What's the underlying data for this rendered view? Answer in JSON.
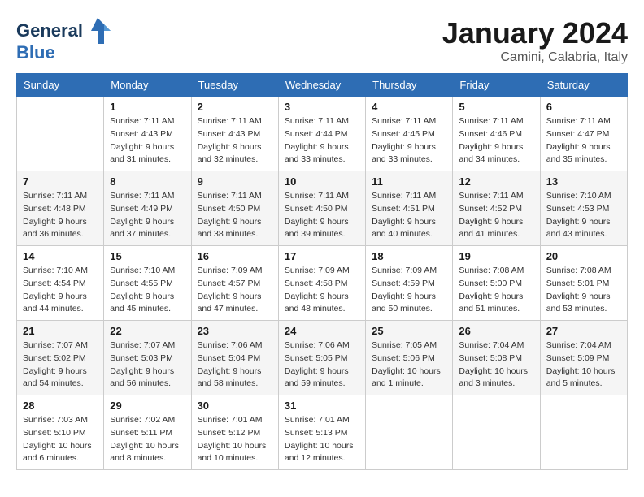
{
  "header": {
    "logo_line1": "General",
    "logo_line2": "Blue",
    "month": "January 2024",
    "location": "Camini, Calabria, Italy"
  },
  "weekdays": [
    "Sunday",
    "Monday",
    "Tuesday",
    "Wednesday",
    "Thursday",
    "Friday",
    "Saturday"
  ],
  "weeks": [
    [
      {
        "day": "",
        "sunrise": "",
        "sunset": "",
        "daylight": ""
      },
      {
        "day": "1",
        "sunrise": "Sunrise: 7:11 AM",
        "sunset": "Sunset: 4:43 PM",
        "daylight": "Daylight: 9 hours and 31 minutes."
      },
      {
        "day": "2",
        "sunrise": "Sunrise: 7:11 AM",
        "sunset": "Sunset: 4:43 PM",
        "daylight": "Daylight: 9 hours and 32 minutes."
      },
      {
        "day": "3",
        "sunrise": "Sunrise: 7:11 AM",
        "sunset": "Sunset: 4:44 PM",
        "daylight": "Daylight: 9 hours and 33 minutes."
      },
      {
        "day": "4",
        "sunrise": "Sunrise: 7:11 AM",
        "sunset": "Sunset: 4:45 PM",
        "daylight": "Daylight: 9 hours and 33 minutes."
      },
      {
        "day": "5",
        "sunrise": "Sunrise: 7:11 AM",
        "sunset": "Sunset: 4:46 PM",
        "daylight": "Daylight: 9 hours and 34 minutes."
      },
      {
        "day": "6",
        "sunrise": "Sunrise: 7:11 AM",
        "sunset": "Sunset: 4:47 PM",
        "daylight": "Daylight: 9 hours and 35 minutes."
      }
    ],
    [
      {
        "day": "7",
        "sunrise": "Sunrise: 7:11 AM",
        "sunset": "Sunset: 4:48 PM",
        "daylight": "Daylight: 9 hours and 36 minutes."
      },
      {
        "day": "8",
        "sunrise": "Sunrise: 7:11 AM",
        "sunset": "Sunset: 4:49 PM",
        "daylight": "Daylight: 9 hours and 37 minutes."
      },
      {
        "day": "9",
        "sunrise": "Sunrise: 7:11 AM",
        "sunset": "Sunset: 4:50 PM",
        "daylight": "Daylight: 9 hours and 38 minutes."
      },
      {
        "day": "10",
        "sunrise": "Sunrise: 7:11 AM",
        "sunset": "Sunset: 4:50 PM",
        "daylight": "Daylight: 9 hours and 39 minutes."
      },
      {
        "day": "11",
        "sunrise": "Sunrise: 7:11 AM",
        "sunset": "Sunset: 4:51 PM",
        "daylight": "Daylight: 9 hours and 40 minutes."
      },
      {
        "day": "12",
        "sunrise": "Sunrise: 7:11 AM",
        "sunset": "Sunset: 4:52 PM",
        "daylight": "Daylight: 9 hours and 41 minutes."
      },
      {
        "day": "13",
        "sunrise": "Sunrise: 7:10 AM",
        "sunset": "Sunset: 4:53 PM",
        "daylight": "Daylight: 9 hours and 43 minutes."
      }
    ],
    [
      {
        "day": "14",
        "sunrise": "Sunrise: 7:10 AM",
        "sunset": "Sunset: 4:54 PM",
        "daylight": "Daylight: 9 hours and 44 minutes."
      },
      {
        "day": "15",
        "sunrise": "Sunrise: 7:10 AM",
        "sunset": "Sunset: 4:55 PM",
        "daylight": "Daylight: 9 hours and 45 minutes."
      },
      {
        "day": "16",
        "sunrise": "Sunrise: 7:09 AM",
        "sunset": "Sunset: 4:57 PM",
        "daylight": "Daylight: 9 hours and 47 minutes."
      },
      {
        "day": "17",
        "sunrise": "Sunrise: 7:09 AM",
        "sunset": "Sunset: 4:58 PM",
        "daylight": "Daylight: 9 hours and 48 minutes."
      },
      {
        "day": "18",
        "sunrise": "Sunrise: 7:09 AM",
        "sunset": "Sunset: 4:59 PM",
        "daylight": "Daylight: 9 hours and 50 minutes."
      },
      {
        "day": "19",
        "sunrise": "Sunrise: 7:08 AM",
        "sunset": "Sunset: 5:00 PM",
        "daylight": "Daylight: 9 hours and 51 minutes."
      },
      {
        "day": "20",
        "sunrise": "Sunrise: 7:08 AM",
        "sunset": "Sunset: 5:01 PM",
        "daylight": "Daylight: 9 hours and 53 minutes."
      }
    ],
    [
      {
        "day": "21",
        "sunrise": "Sunrise: 7:07 AM",
        "sunset": "Sunset: 5:02 PM",
        "daylight": "Daylight: 9 hours and 54 minutes."
      },
      {
        "day": "22",
        "sunrise": "Sunrise: 7:07 AM",
        "sunset": "Sunset: 5:03 PM",
        "daylight": "Daylight: 9 hours and 56 minutes."
      },
      {
        "day": "23",
        "sunrise": "Sunrise: 7:06 AM",
        "sunset": "Sunset: 5:04 PM",
        "daylight": "Daylight: 9 hours and 58 minutes."
      },
      {
        "day": "24",
        "sunrise": "Sunrise: 7:06 AM",
        "sunset": "Sunset: 5:05 PM",
        "daylight": "Daylight: 9 hours and 59 minutes."
      },
      {
        "day": "25",
        "sunrise": "Sunrise: 7:05 AM",
        "sunset": "Sunset: 5:06 PM",
        "daylight": "Daylight: 10 hours and 1 minute."
      },
      {
        "day": "26",
        "sunrise": "Sunrise: 7:04 AM",
        "sunset": "Sunset: 5:08 PM",
        "daylight": "Daylight: 10 hours and 3 minutes."
      },
      {
        "day": "27",
        "sunrise": "Sunrise: 7:04 AM",
        "sunset": "Sunset: 5:09 PM",
        "daylight": "Daylight: 10 hours and 5 minutes."
      }
    ],
    [
      {
        "day": "28",
        "sunrise": "Sunrise: 7:03 AM",
        "sunset": "Sunset: 5:10 PM",
        "daylight": "Daylight: 10 hours and 6 minutes."
      },
      {
        "day": "29",
        "sunrise": "Sunrise: 7:02 AM",
        "sunset": "Sunset: 5:11 PM",
        "daylight": "Daylight: 10 hours and 8 minutes."
      },
      {
        "day": "30",
        "sunrise": "Sunrise: 7:01 AM",
        "sunset": "Sunset: 5:12 PM",
        "daylight": "Daylight: 10 hours and 10 minutes."
      },
      {
        "day": "31",
        "sunrise": "Sunrise: 7:01 AM",
        "sunset": "Sunset: 5:13 PM",
        "daylight": "Daylight: 10 hours and 12 minutes."
      },
      {
        "day": "",
        "sunrise": "",
        "sunset": "",
        "daylight": ""
      },
      {
        "day": "",
        "sunrise": "",
        "sunset": "",
        "daylight": ""
      },
      {
        "day": "",
        "sunrise": "",
        "sunset": "",
        "daylight": ""
      }
    ]
  ]
}
